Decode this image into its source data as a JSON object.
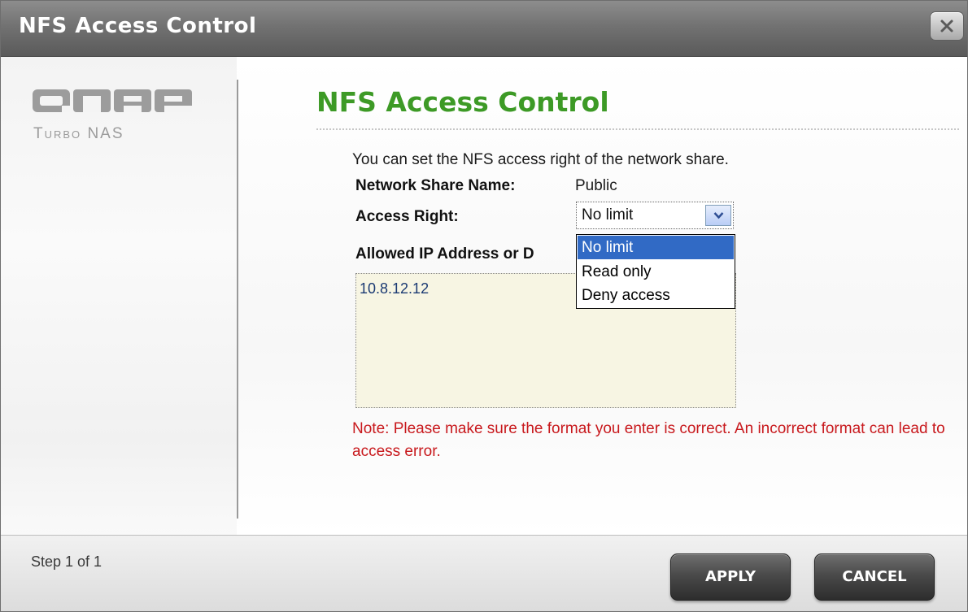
{
  "window": {
    "title": "NFS Access Control"
  },
  "brand": {
    "logo_text": "QNAP",
    "sub_text": "Turbo NAS"
  },
  "main": {
    "heading": "NFS Access Control",
    "description": "You can set the NFS access right of the network share.",
    "share_name_label": "Network Share Name:",
    "share_name_value": "Public",
    "access_right_label": "Access Right:",
    "access_right_selected": "No limit",
    "access_right_options": [
      "No limit",
      "Read only",
      "Deny access"
    ],
    "allowed_ip_label": "Allowed IP Address or D",
    "allowed_ip_value": "10.8.12.12",
    "note": "Note: Please make sure the format you enter is correct. An incorrect format can lead to access error."
  },
  "footer": {
    "step_text": "Step 1 of 1",
    "apply_label": "APPLY",
    "cancel_label": "CANCEL"
  },
  "colors": {
    "heading_green": "#3d9a26",
    "note_red": "#c8191d",
    "selected_option_blue": "#316ac5",
    "ip_box_bg": "#f7f5e3"
  },
  "icons": {
    "close": "close-icon",
    "dropdown": "chevron-down-icon"
  }
}
